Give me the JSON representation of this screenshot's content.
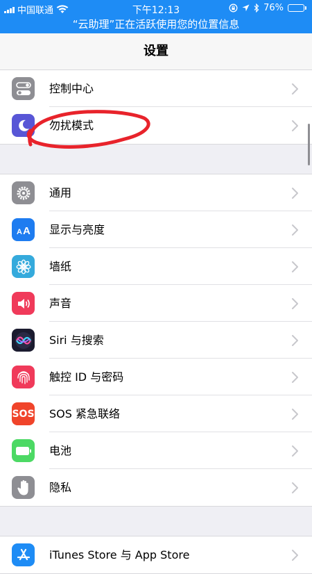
{
  "status_bar": {
    "carrier": "中国联通",
    "time": "下午12:13",
    "battery_percent": "76%",
    "battery_level": 0.76,
    "icons": [
      "signal-icon",
      "wifi-icon",
      "orientation-lock-icon",
      "location-arrow-icon",
      "bluetooth-icon",
      "battery-icon"
    ]
  },
  "location_banner": {
    "text": "“云助理”正在活跃使用您的位置信息"
  },
  "nav": {
    "title": "设置"
  },
  "groups": [
    {
      "items": [
        {
          "label": "控制中心",
          "icon": "control-center-icon",
          "color": "#8e8e93"
        },
        {
          "label": "勿扰模式",
          "icon": "moon-icon",
          "color": "#5856d6"
        }
      ]
    },
    {
      "items": [
        {
          "label": "通用",
          "icon": "gear-icon",
          "color": "#8e8e93"
        },
        {
          "label": "显示与亮度",
          "icon": "text-size-icon",
          "color": "#1e7cf0"
        },
        {
          "label": "墙纸",
          "icon": "flower-icon",
          "color": "#35aadc"
        },
        {
          "label": "声音",
          "icon": "speaker-icon",
          "color": "#f03a5a"
        },
        {
          "label": "Siri 与搜索",
          "icon": "siri-icon",
          "color": "#1b1b2f"
        },
        {
          "label": "触控 ID 与密码",
          "icon": "fingerprint-icon",
          "color": "#f03a5a"
        },
        {
          "label": "SOS 紧急联络",
          "icon": "sos-icon",
          "color": "#f0442a",
          "icon_text": "SOS"
        },
        {
          "label": "电池",
          "icon": "battery-green-icon",
          "color": "#4cd964"
        },
        {
          "label": "隐私",
          "icon": "hand-icon",
          "color": "#8e8e93"
        }
      ]
    },
    {
      "items": [
        {
          "label": "iTunes Store 与 App Store",
          "icon": "app-store-icon",
          "color": "#1e8cf5"
        }
      ]
    }
  ],
  "annotation": {
    "color": "#e8232b",
    "target": "勿扰模式"
  }
}
